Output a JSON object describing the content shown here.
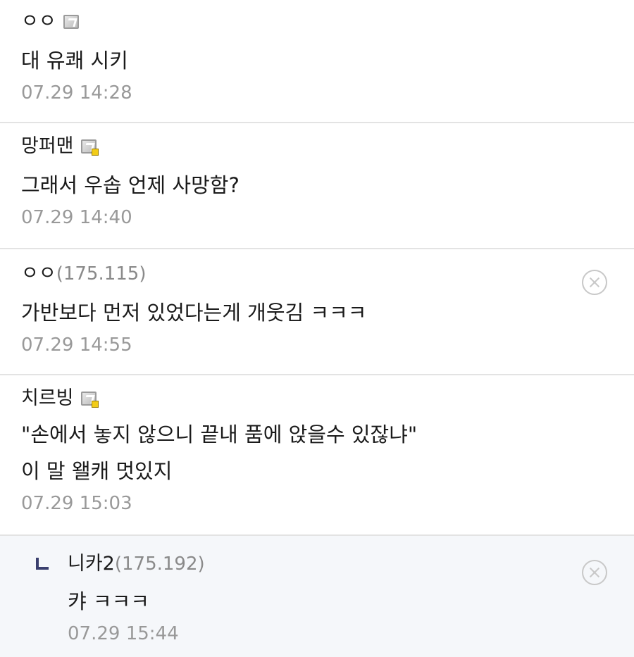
{
  "comments": [
    {
      "nickname": "ㅇㅇ",
      "ip": "",
      "body_lines": [
        "대 유쾌 시키"
      ],
      "date": "07.29 14:28",
      "gallog_icon": "gallog-icon"
    },
    {
      "nickname": "망퍼맨",
      "ip": "",
      "body_lines": [
        "그래서 우솝 언제 사망함?"
      ],
      "date": "07.29 14:40",
      "gallog_icon": "gallog-sub-icon"
    },
    {
      "nickname": "ㅇㅇ",
      "ip": "(175.115)",
      "body_lines": [
        "가반보다 먼저 있었다는게 개웃김 ㅋㅋㅋ"
      ],
      "date": "07.29 14:55",
      "delete_icon": "delete-icon"
    },
    {
      "nickname": "치르빙",
      "ip": "",
      "body_lines": [
        "\"손에서 놓지 않으니 끝내 품에 앉을수 있잖냐\"",
        "이 말 왤캐 멋있지"
      ],
      "date": "07.29 15:03",
      "gallog_icon": "gallog-sub-icon"
    }
  ],
  "reply": {
    "nickname": "니카2",
    "ip": "(175.192)",
    "body": "캬 ㅋㅋㅋ",
    "date": "07.29 15:44",
    "delete_icon": "delete-icon",
    "reply_icon": "reply-arrow-icon"
  },
  "colors": {
    "text": "#1a1a1a",
    "muted": "#999999",
    "divider": "#e3e3e3",
    "reply_bg": "#f5f7fa",
    "reply_arrow": "#3a3f6e"
  }
}
